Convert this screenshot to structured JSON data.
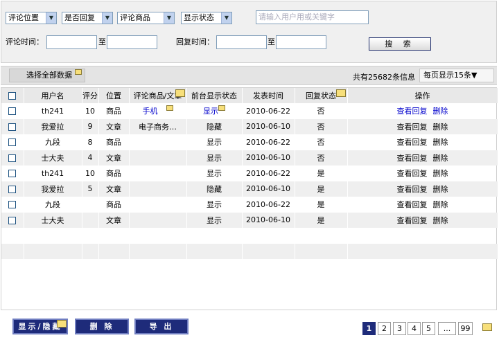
{
  "filters": {
    "position_select": "评论位置",
    "reply_select": "是否回复",
    "target_select": "评论商品",
    "status_select": "显示状态",
    "search_placeholder": "请输入用户用或关键字",
    "comment_time_label": "评论时间：",
    "to_label": "至",
    "reply_time_label": "回复时间：",
    "search_button": "搜 索"
  },
  "toolbar": {
    "select_all": "选择全部数据",
    "total_info": "共有25682条信息",
    "per_page": "每页显示15条▼"
  },
  "table": {
    "headers": [
      "用户名",
      "评分",
      "位置",
      "评论商品/文章",
      "前台显示状态",
      "发表时间",
      "回复状态",
      "操作"
    ],
    "rows": [
      {
        "user": "th241",
        "score": "10",
        "pos": "商品",
        "target": "手机",
        "status": "显示",
        "time": "2010-06-22",
        "reply": "否",
        "view": "查看回复",
        "del": "删除"
      },
      {
        "user": "我爱拉",
        "score": "9",
        "pos": "文章",
        "target": "电子商务…",
        "status": "隐藏",
        "time": "2010-06-10",
        "reply": "否",
        "view": "查看回复",
        "del": "删除"
      },
      {
        "user": "九段",
        "score": "8",
        "pos": "商品",
        "target": "",
        "status": "显示",
        "time": "2010-06-22",
        "reply": "否",
        "view": "查看回复",
        "del": "删除"
      },
      {
        "user": "士大夫",
        "score": "4",
        "pos": "文章",
        "target": "",
        "status": "显示",
        "time": "2010-06-10",
        "reply": "否",
        "view": "查看回复",
        "del": "删除"
      },
      {
        "user": "th241",
        "score": "10",
        "pos": "商品",
        "target": "",
        "status": "显示",
        "time": "2010-06-22",
        "reply": "是",
        "view": "查看回复",
        "del": "删除"
      },
      {
        "user": "我爱拉",
        "score": "5",
        "pos": "文章",
        "target": "",
        "status": "隐藏",
        "time": "2010-06-10",
        "reply": "是",
        "view": "查看回复",
        "del": "删除"
      },
      {
        "user": "九段",
        "score": "",
        "pos": "商品",
        "target": "",
        "status": "显示",
        "time": "2010-06-22",
        "reply": "是",
        "view": "查看回复",
        "del": "删除"
      },
      {
        "user": "士大夫",
        "score": "",
        "pos": "文章",
        "target": "",
        "status": "显示",
        "time": "2010-06-10",
        "reply": "是",
        "view": "查看回复",
        "del": "删除"
      }
    ]
  },
  "footer": {
    "toggle_button": "显示/隐藏",
    "delete_button": "删 除",
    "export_button": "导 出",
    "pages": [
      "1",
      "2",
      "3",
      "4",
      "5",
      "...",
      "99"
    ],
    "current_page": "1"
  },
  "colors": {
    "accent": "#1e2b7a",
    "link": "#0000cc",
    "note": "#f7df7a"
  }
}
